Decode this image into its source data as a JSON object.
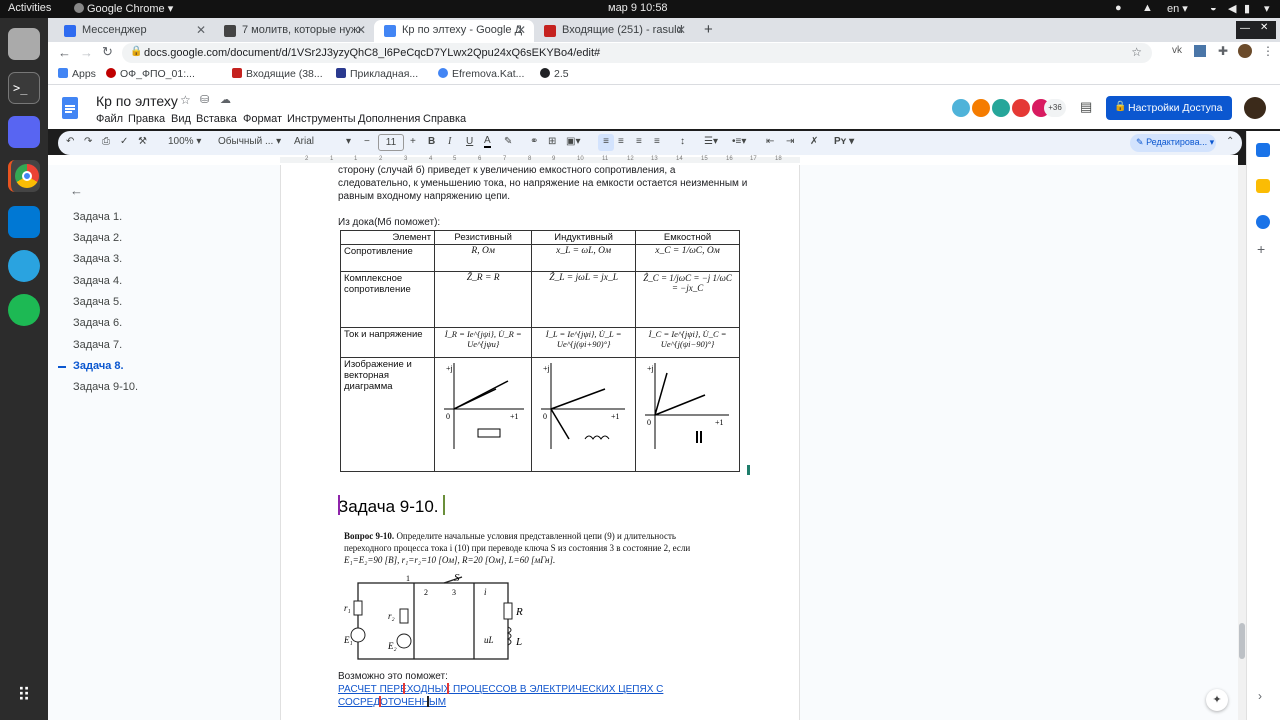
{
  "system": {
    "activities": "Activities",
    "app_name": "Google Chrome",
    "clock": "мар 9  10:58",
    "lang": "en"
  },
  "browser": {
    "tabs": [
      {
        "title": "Мессенджер",
        "color": "#2e6bf0"
      },
      {
        "title": "7 молитв, которые нужно",
        "color": "#444444"
      },
      {
        "title": "Кр по элтеху - Google Доку",
        "color": "#4285f4"
      },
      {
        "title": "Входящие (251) - rasulda",
        "color": "#c5221f"
      }
    ],
    "new_tab": "+",
    "url": "docs.google.com/document/d/1VSr2J3yzyQhC8_l6PeCqcD7YLwx2Qpu24xQ6sEKYBo4/edit#",
    "bookmarks": [
      {
        "label": "Apps",
        "color": "#4285f4"
      },
      {
        "label": "ОФ_ФПО_01:...",
        "color": "#c00000"
      },
      {
        "label": "Входящие (38...",
        "color": "#c5221f"
      },
      {
        "label": "Прикладная...",
        "color": "#2b3a8f"
      },
      {
        "label": "Efremova.Kat...",
        "color": "#4285f4"
      },
      {
        "label": "2.5",
        "color": "#202124"
      }
    ]
  },
  "doc": {
    "title": "Кр по элтеху",
    "menu": [
      "Файл",
      "Правка",
      "Вид",
      "Вставка",
      "Формат",
      "Инструменты",
      "Дополнения",
      "Справка"
    ],
    "more_users": "+36",
    "share_label": "Настройки Доступа",
    "toolbar": {
      "zoom": "100%",
      "style": "Обычный ...",
      "font": "Arial",
      "minus": "−",
      "size": "11",
      "plus": "+",
      "bold": "B",
      "italic": "I",
      "underline": "U",
      "color_a": "A",
      "mode": "Редактирова..."
    },
    "ruler_marks": [
      "2",
      "1",
      "1",
      "2",
      "3",
      "4",
      "5",
      "6",
      "7",
      "8",
      "9",
      "10",
      "11",
      "12",
      "13",
      "14",
      "15",
      "16",
      "17",
      "18"
    ],
    "outline": [
      "Задача 1.",
      "Задача 2.",
      "Задача 3.",
      "Задача 4.",
      "Задача 5.",
      "Задача 6.",
      "Задача 7.",
      "Задача 8.",
      "Задача 9-10."
    ],
    "outline_active": 7,
    "body": {
      "line1": "сторону (случай б) приведет к увеличению емкостного сопротивления, а",
      "line2": "следовательно, к уменьшению тока, но напряжение на емкости остается неизменным и",
      "line3": "равным входному напряжению цепи.",
      "doka": "Из дока(Мб поможет):",
      "heading": "Задача 9-10.",
      "q_title": "Вопрос 9-10.",
      "q_line1": "Определите начальные условия представленной цепи (9) и длительность",
      "q_line2": "переходного процесса тока i (10) при переводе ключа S из состояния 3 в состояние 2, если",
      "q_line3": "E₁=E₂=90 [В], r₁=r₂=10 [Ом], R=20 [Ом], L=60 [мГн].",
      "maybe": "Возможно это поможет:",
      "link1": "РАСЧЕТ ПЕРЕХОДНЫХ ПРОЦЕССОВ В ЭЛЕКТРИЧЕСКИХ ЦЕПЯХ С",
      "link2": "СОСРЕДОТОЧЕННЫМ"
    },
    "table": {
      "headers": [
        "Элемент",
        "Резистивный",
        "Индуктивный",
        "Емкостной"
      ],
      "rows": [
        {
          "label": "Сопротивление",
          "cells": [
            "R, Ом",
            "x_L = ωL, Ом",
            "x_C = 1/ωC, Ом"
          ]
        },
        {
          "label": "Комплексное сопротивление",
          "cells": [
            "Ẑ_R = R",
            "Ẑ_L = jωL = jx_L",
            "Ẑ_C = 1/jωC = −j 1/ωC = −jx_C"
          ]
        },
        {
          "label": "Ток и напряжение",
          "cells": [
            "İ_R = Ie^{jψi}, U̇_R = Ue^{jψu}",
            "İ_L = Ie^{jψi}, U̇_L = Ue^{j(ψi+90)°}",
            "İ_C = Ie^{jψi}, U̇_C = Ue^{j(ψi−90)°}"
          ]
        },
        {
          "label": "Изображение и векторная диаграмма",
          "cells": [
            "",
            "",
            ""
          ]
        }
      ],
      "diag_labels": {
        "plus_j": "+j",
        "plus_1": "+1",
        "zero": "0"
      }
    },
    "circuit": {
      "S": "S",
      "n1": "1",
      "n2": "2",
      "n3": "3",
      "R": "R",
      "L": "L",
      "r1": "r₁",
      "r2": "r₂",
      "E1": "E₁",
      "E2": "E₂",
      "uL": "uL",
      "i": "i"
    }
  }
}
